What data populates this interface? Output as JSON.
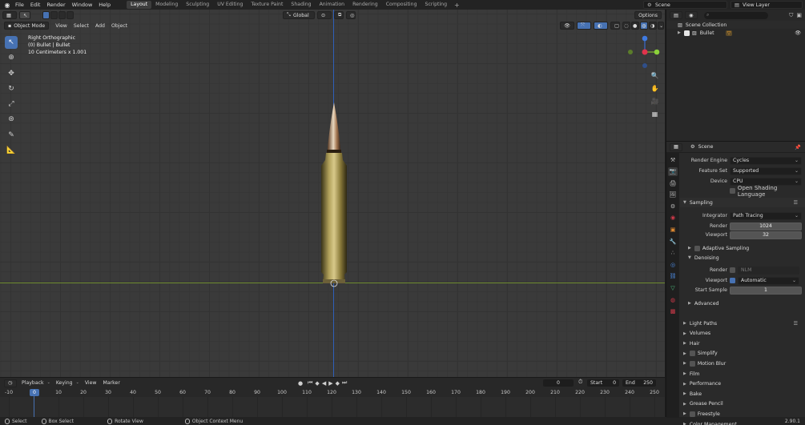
{
  "topbar": {
    "menus": [
      "File",
      "Edit",
      "Render",
      "Window",
      "Help"
    ],
    "workspaces": [
      "Layout",
      "Modeling",
      "Sculpting",
      "UV Editing",
      "Texture Paint",
      "Shading",
      "Animation",
      "Rendering",
      "Compositing",
      "Scripting"
    ],
    "active_workspace": "Layout",
    "add_tab": "+",
    "scene": "Scene",
    "view_layer": "View Layer"
  },
  "viewport": {
    "mode": "Object Mode",
    "menus": [
      "View",
      "Select",
      "Add",
      "Object"
    ],
    "orientation": "Global",
    "options": "Options",
    "overlay_lines": [
      "Right Orthographic",
      "(0) Bullet | Bullet",
      "10 Centimeters x 1.001"
    ],
    "gizmo": {
      "z": "Z",
      "y": "Y"
    }
  },
  "timeline": {
    "menus": [
      "Playback",
      "Keying",
      "View",
      "Marker"
    ],
    "current_frame": "0",
    "start_label": "Start",
    "start": "0",
    "end_label": "End",
    "end": "250",
    "ticks": [
      "-10",
      "0",
      "10",
      "20",
      "30",
      "40",
      "50",
      "60",
      "70",
      "80",
      "90",
      "100",
      "110",
      "120",
      "130",
      "140",
      "150",
      "160",
      "170",
      "180",
      "190",
      "200",
      "210",
      "220",
      "230",
      "240",
      "250"
    ],
    "frame_marker": "0"
  },
  "statusbar": {
    "items": [
      "Select",
      "Box Select",
      "Rotate View",
      "Object Context Menu"
    ],
    "version": "2.90.1"
  },
  "outliner": {
    "search_placeholder": "",
    "rows": [
      "Scene Collection",
      "Bullet"
    ]
  },
  "properties": {
    "context": "Scene",
    "render_engine_label": "Render Engine",
    "render_engine": "Cycles",
    "feature_set_label": "Feature Set",
    "feature_set": "Supported",
    "device_label": "Device",
    "device": "CPU",
    "osl_label": "Open Shading Language",
    "sampling": "Sampling",
    "integrator_label": "Integrator",
    "integrator": "Path Tracing",
    "render_label": "Render",
    "render_samples": "1024",
    "viewport_label": "Viewport",
    "viewport_samples": "32",
    "adaptive_sampling": "Adaptive Sampling",
    "denoising": "Denoising",
    "denoise_render_label": "Render",
    "denoise_render_value": "NLM",
    "denoise_viewport_label": "Viewport",
    "denoise_viewport_value": "Automatic",
    "start_sample_label": "Start Sample",
    "start_sample": "1",
    "advanced": "Advanced",
    "sections": [
      "Light Paths",
      "Volumes",
      "Hair",
      "Simplify",
      "Motion Blur",
      "Film",
      "Performance",
      "Bake",
      "Grease Pencil",
      "Freestyle",
      "Color Management"
    ]
  }
}
